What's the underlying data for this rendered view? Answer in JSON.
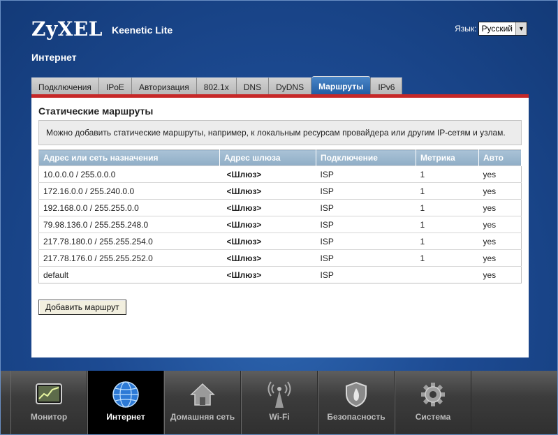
{
  "header": {
    "logo": "ZyXEL",
    "model": "Keenetic Lite",
    "language_label": "Язык:",
    "language_value": "Русский"
  },
  "section_title": "Интернет",
  "tabs": [
    {
      "label": "Подключения",
      "active": false
    },
    {
      "label": "IPoE",
      "active": false
    },
    {
      "label": "Авторизация",
      "active": false
    },
    {
      "label": "802.1x",
      "active": false
    },
    {
      "label": "DNS",
      "active": false
    },
    {
      "label": "DyDNS",
      "active": false
    },
    {
      "label": "Маршруты",
      "active": true
    },
    {
      "label": "IPv6",
      "active": false
    }
  ],
  "page": {
    "heading": "Статические маршруты",
    "info": "Можно добавить статические маршруты, например, к локальным ресурсам провайдера или другим IP-сетям и узлам.",
    "columns": [
      "Адрес или сеть назначения",
      "Адрес шлюза",
      "Подключение",
      "Метрика",
      "Авто"
    ],
    "rows": [
      [
        "10.0.0.0 / 255.0.0.0",
        "<Шлюз>",
        "ISP",
        "1",
        "yes"
      ],
      [
        "172.16.0.0 / 255.240.0.0",
        "<Шлюз>",
        "ISP",
        "1",
        "yes"
      ],
      [
        "192.168.0.0 / 255.255.0.0",
        "<Шлюз>",
        "ISP",
        "1",
        "yes"
      ],
      [
        "79.98.136.0 / 255.255.248.0",
        "<Шлюз>",
        "ISP",
        "1",
        "yes"
      ],
      [
        "217.78.180.0 / 255.255.254.0",
        "<Шлюз>",
        "ISP",
        "1",
        "yes"
      ],
      [
        "217.78.176.0 / 255.255.252.0",
        "<Шлюз>",
        "ISP",
        "1",
        "yes"
      ],
      [
        "default",
        "<Шлюз>",
        "ISP",
        "",
        "yes"
      ]
    ],
    "add_button": "Добавить маршрут"
  },
  "bottom_nav": [
    {
      "label": "Монитор",
      "icon": "monitor-icon",
      "active": false
    },
    {
      "label": "Интернет",
      "icon": "globe-icon",
      "active": true
    },
    {
      "label": "Домашняя сеть",
      "icon": "home-icon",
      "active": false
    },
    {
      "label": "Wi-Fi",
      "icon": "wifi-antenna-icon",
      "active": false
    },
    {
      "label": "Безопасность",
      "icon": "shield-icon",
      "active": false
    },
    {
      "label": "Система",
      "icon": "gear-icon",
      "active": false
    }
  ],
  "colors": {
    "accent_red": "#c62828",
    "active_tab": "#1f5aa0",
    "table_header": "#9bb6cd"
  }
}
